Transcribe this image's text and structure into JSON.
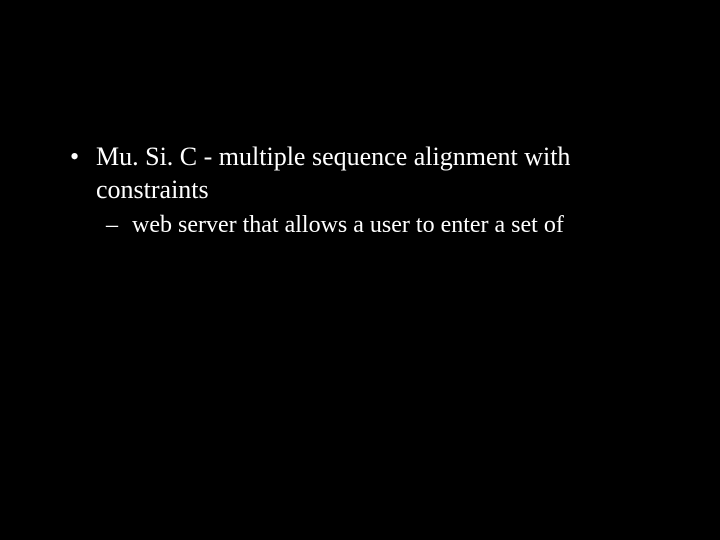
{
  "slide": {
    "bullets": [
      {
        "text": "Mu. Si. C  - multiple sequence alignment with constraints",
        "sub": [
          {
            "text": "web server that allows a user to enter a set of"
          }
        ]
      }
    ]
  }
}
